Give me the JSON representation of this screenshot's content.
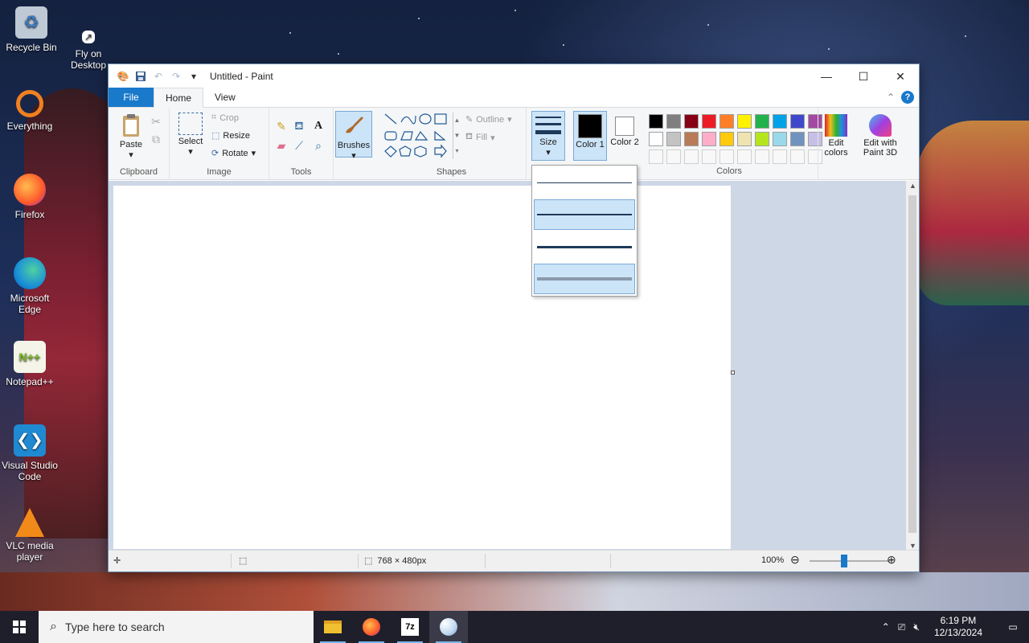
{
  "desktop": {
    "icons": [
      {
        "label": "Recycle Bin",
        "icon": "recycle-bin-icon"
      },
      {
        "label": "Fly on Desktop",
        "icon": "fly-icon"
      },
      {
        "label": "Everything",
        "icon": "everything-search-icon"
      },
      {
        "label": "Firefox",
        "icon": "firefox-icon"
      },
      {
        "label": "Microsoft Edge",
        "icon": "edge-icon"
      },
      {
        "label": "Notepad++",
        "icon": "notepadpp-icon"
      },
      {
        "label": "Visual Studio Code",
        "icon": "vscode-icon"
      },
      {
        "label": "VLC media player",
        "icon": "vlc-icon"
      }
    ]
  },
  "paint": {
    "title": "Untitled - Paint",
    "tabs": {
      "file": "File",
      "home": "Home",
      "view": "View"
    },
    "clipboard": {
      "label": "Clipboard",
      "paste": "Paste"
    },
    "image": {
      "label": "Image",
      "select": "Select",
      "crop": "Crop",
      "resize": "Resize",
      "rotate": "Rotate"
    },
    "tools": {
      "label": "Tools"
    },
    "brushes": {
      "label": "Brushes"
    },
    "shapes": {
      "label": "Shapes",
      "outline": "Outline",
      "fill": "Fill"
    },
    "size": {
      "label": "Size"
    },
    "colors": {
      "label": "Colors",
      "color1": "Color 1",
      "color2": "Color 2",
      "edit_colors": "Edit colors",
      "edit_paint3d": "Edit with Paint 3D",
      "color1_value": "#000000",
      "color2_value": "#ffffff",
      "palette_row1": [
        "#000000",
        "#7f7f7f",
        "#880015",
        "#ed1c24",
        "#ff7f27",
        "#fff200",
        "#22b14c",
        "#00a2e8",
        "#3f48cc",
        "#a349a4"
      ],
      "palette_row2": [
        "#ffffff",
        "#c3c3c3",
        "#b97a57",
        "#ffaec9",
        "#ffc90e",
        "#efe4b0",
        "#b5e61d",
        "#99d9ea",
        "#7092be",
        "#c8bfe7"
      ]
    },
    "size_dropdown": {
      "options": [
        {
          "thickness_px": 1,
          "highlighted": false
        },
        {
          "thickness_px": 3,
          "highlighted": true
        },
        {
          "thickness_px": 5,
          "highlighted": false
        },
        {
          "thickness_px": 8,
          "highlighted": true
        }
      ]
    },
    "status": {
      "dimensions": "768 × 480px",
      "zoom": "100%"
    }
  },
  "taskbar": {
    "search_placeholder": "Type here to search",
    "time": "6:19 PM",
    "date": "12/13/2024",
    "apps": [
      "file-explorer-icon",
      "firefox-icon",
      "7zip-icon",
      "paint-icon"
    ]
  }
}
